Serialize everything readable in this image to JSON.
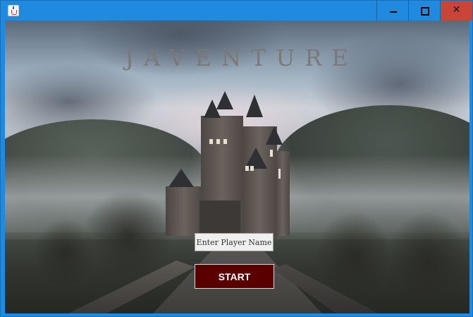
{
  "window": {
    "title": "",
    "app_icon": "java-cup-icon",
    "controls": [
      "minimize-icon",
      "maximize-icon",
      "close-icon"
    ],
    "close_glyph": "✕",
    "accent_color": "#1f8ae0",
    "close_color": "#c9453a"
  },
  "main": {
    "title": "JAVENTURE",
    "name_field": {
      "value": "Enter Player Name",
      "placeholder": ""
    },
    "start_label": "START",
    "start_color": "#5a0000"
  }
}
